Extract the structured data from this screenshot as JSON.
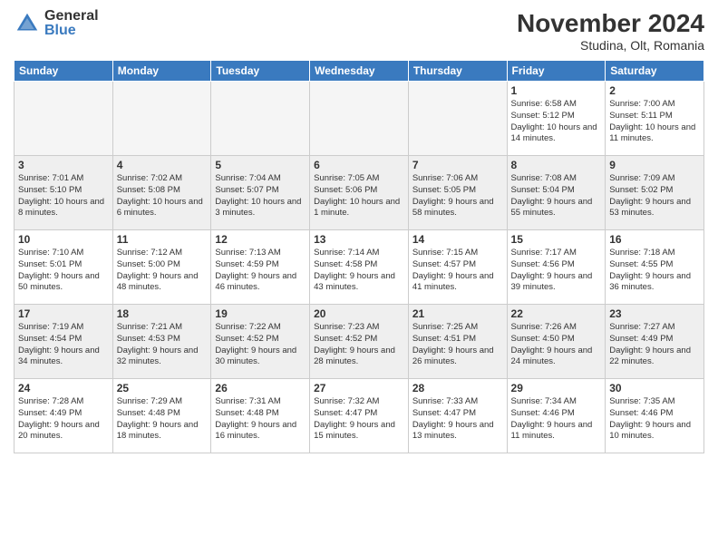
{
  "logo": {
    "general": "General",
    "blue": "Blue"
  },
  "title": "November 2024",
  "location": "Studina, Olt, Romania",
  "days_of_week": [
    "Sunday",
    "Monday",
    "Tuesday",
    "Wednesday",
    "Thursday",
    "Friday",
    "Saturday"
  ],
  "weeks": [
    {
      "days": [
        {
          "num": "",
          "info": "",
          "empty": true
        },
        {
          "num": "",
          "info": "",
          "empty": true
        },
        {
          "num": "",
          "info": "",
          "empty": true
        },
        {
          "num": "",
          "info": "",
          "empty": true
        },
        {
          "num": "",
          "info": "",
          "empty": true
        },
        {
          "num": "1",
          "info": "Sunrise: 6:58 AM\nSunset: 5:12 PM\nDaylight: 10 hours and 14 minutes."
        },
        {
          "num": "2",
          "info": "Sunrise: 7:00 AM\nSunset: 5:11 PM\nDaylight: 10 hours and 11 minutes."
        }
      ]
    },
    {
      "days": [
        {
          "num": "3",
          "info": "Sunrise: 7:01 AM\nSunset: 5:10 PM\nDaylight: 10 hours and 8 minutes."
        },
        {
          "num": "4",
          "info": "Sunrise: 7:02 AM\nSunset: 5:08 PM\nDaylight: 10 hours and 6 minutes."
        },
        {
          "num": "5",
          "info": "Sunrise: 7:04 AM\nSunset: 5:07 PM\nDaylight: 10 hours and 3 minutes."
        },
        {
          "num": "6",
          "info": "Sunrise: 7:05 AM\nSunset: 5:06 PM\nDaylight: 10 hours and 1 minute."
        },
        {
          "num": "7",
          "info": "Sunrise: 7:06 AM\nSunset: 5:05 PM\nDaylight: 9 hours and 58 minutes."
        },
        {
          "num": "8",
          "info": "Sunrise: 7:08 AM\nSunset: 5:04 PM\nDaylight: 9 hours and 55 minutes."
        },
        {
          "num": "9",
          "info": "Sunrise: 7:09 AM\nSunset: 5:02 PM\nDaylight: 9 hours and 53 minutes."
        }
      ]
    },
    {
      "days": [
        {
          "num": "10",
          "info": "Sunrise: 7:10 AM\nSunset: 5:01 PM\nDaylight: 9 hours and 50 minutes."
        },
        {
          "num": "11",
          "info": "Sunrise: 7:12 AM\nSunset: 5:00 PM\nDaylight: 9 hours and 48 minutes."
        },
        {
          "num": "12",
          "info": "Sunrise: 7:13 AM\nSunset: 4:59 PM\nDaylight: 9 hours and 46 minutes."
        },
        {
          "num": "13",
          "info": "Sunrise: 7:14 AM\nSunset: 4:58 PM\nDaylight: 9 hours and 43 minutes."
        },
        {
          "num": "14",
          "info": "Sunrise: 7:15 AM\nSunset: 4:57 PM\nDaylight: 9 hours and 41 minutes."
        },
        {
          "num": "15",
          "info": "Sunrise: 7:17 AM\nSunset: 4:56 PM\nDaylight: 9 hours and 39 minutes."
        },
        {
          "num": "16",
          "info": "Sunrise: 7:18 AM\nSunset: 4:55 PM\nDaylight: 9 hours and 36 minutes."
        }
      ]
    },
    {
      "days": [
        {
          "num": "17",
          "info": "Sunrise: 7:19 AM\nSunset: 4:54 PM\nDaylight: 9 hours and 34 minutes."
        },
        {
          "num": "18",
          "info": "Sunrise: 7:21 AM\nSunset: 4:53 PM\nDaylight: 9 hours and 32 minutes."
        },
        {
          "num": "19",
          "info": "Sunrise: 7:22 AM\nSunset: 4:52 PM\nDaylight: 9 hours and 30 minutes."
        },
        {
          "num": "20",
          "info": "Sunrise: 7:23 AM\nSunset: 4:52 PM\nDaylight: 9 hours and 28 minutes."
        },
        {
          "num": "21",
          "info": "Sunrise: 7:25 AM\nSunset: 4:51 PM\nDaylight: 9 hours and 26 minutes."
        },
        {
          "num": "22",
          "info": "Sunrise: 7:26 AM\nSunset: 4:50 PM\nDaylight: 9 hours and 24 minutes."
        },
        {
          "num": "23",
          "info": "Sunrise: 7:27 AM\nSunset: 4:49 PM\nDaylight: 9 hours and 22 minutes."
        }
      ]
    },
    {
      "days": [
        {
          "num": "24",
          "info": "Sunrise: 7:28 AM\nSunset: 4:49 PM\nDaylight: 9 hours and 20 minutes."
        },
        {
          "num": "25",
          "info": "Sunrise: 7:29 AM\nSunset: 4:48 PM\nDaylight: 9 hours and 18 minutes."
        },
        {
          "num": "26",
          "info": "Sunrise: 7:31 AM\nSunset: 4:48 PM\nDaylight: 9 hours and 16 minutes."
        },
        {
          "num": "27",
          "info": "Sunrise: 7:32 AM\nSunset: 4:47 PM\nDaylight: 9 hours and 15 minutes."
        },
        {
          "num": "28",
          "info": "Sunrise: 7:33 AM\nSunset: 4:47 PM\nDaylight: 9 hours and 13 minutes."
        },
        {
          "num": "29",
          "info": "Sunrise: 7:34 AM\nSunset: 4:46 PM\nDaylight: 9 hours and 11 minutes."
        },
        {
          "num": "30",
          "info": "Sunrise: 7:35 AM\nSunset: 4:46 PM\nDaylight: 9 hours and 10 minutes."
        }
      ]
    }
  ]
}
